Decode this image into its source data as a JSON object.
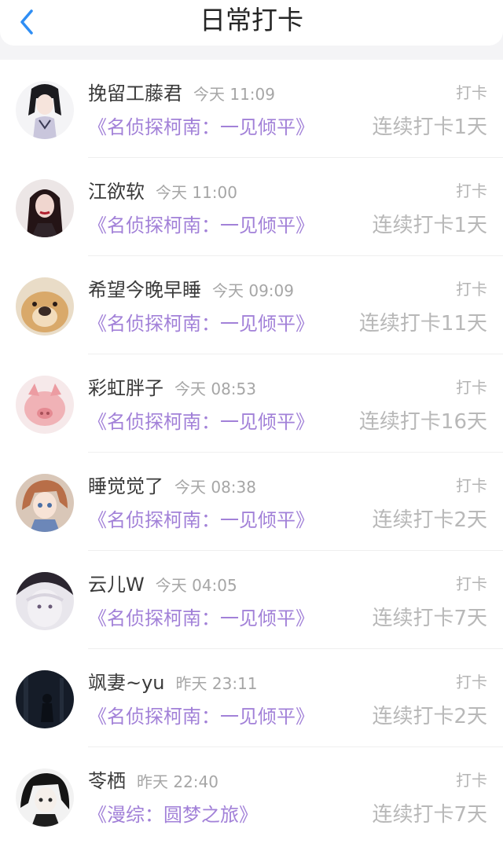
{
  "header": {
    "title": "日常打卡"
  },
  "entries": [
    {
      "name": "挽留工藤君",
      "time": "今天 11:09",
      "tag": "打卡",
      "book": "《名侦探柯南：一见倾平》",
      "streak": "连续打卡1天"
    },
    {
      "name": "江欲软",
      "time": "今天 11:00",
      "tag": "打卡",
      "book": "《名侦探柯南：一见倾平》",
      "streak": "连续打卡1天"
    },
    {
      "name": "希望今晚早睡",
      "time": "今天 09:09",
      "tag": "打卡",
      "book": "《名侦探柯南：一见倾平》",
      "streak": "连续打卡11天"
    },
    {
      "name": "彩虹胖子",
      "time": "今天 08:53",
      "tag": "打卡",
      "book": "《名侦探柯南：一见倾平》",
      "streak": "连续打卡16天"
    },
    {
      "name": "睡觉觉了",
      "time": "今天 08:38",
      "tag": "打卡",
      "book": "《名侦探柯南：一见倾平》",
      "streak": "连续打卡2天"
    },
    {
      "name": "云儿W",
      "time": "今天 04:05",
      "tag": "打卡",
      "book": "《名侦探柯南：一见倾平》",
      "streak": "连续打卡7天"
    },
    {
      "name": "飒妻~yu",
      "time": "昨天 23:11",
      "tag": "打卡",
      "book": "《名侦探柯南：一见倾平》",
      "streak": "连续打卡2天"
    },
    {
      "name": "苓栖",
      "time": "昨天 22:40",
      "tag": "打卡",
      "book": "《漫综：圆梦之旅》",
      "streak": "连续打卡7天"
    }
  ],
  "colors": {
    "accent_blue": "#2f8ef4",
    "book_purple": "#a281d8",
    "muted_gray": "#b8b8b8"
  },
  "icons": {
    "back": "chevron-left-icon"
  }
}
